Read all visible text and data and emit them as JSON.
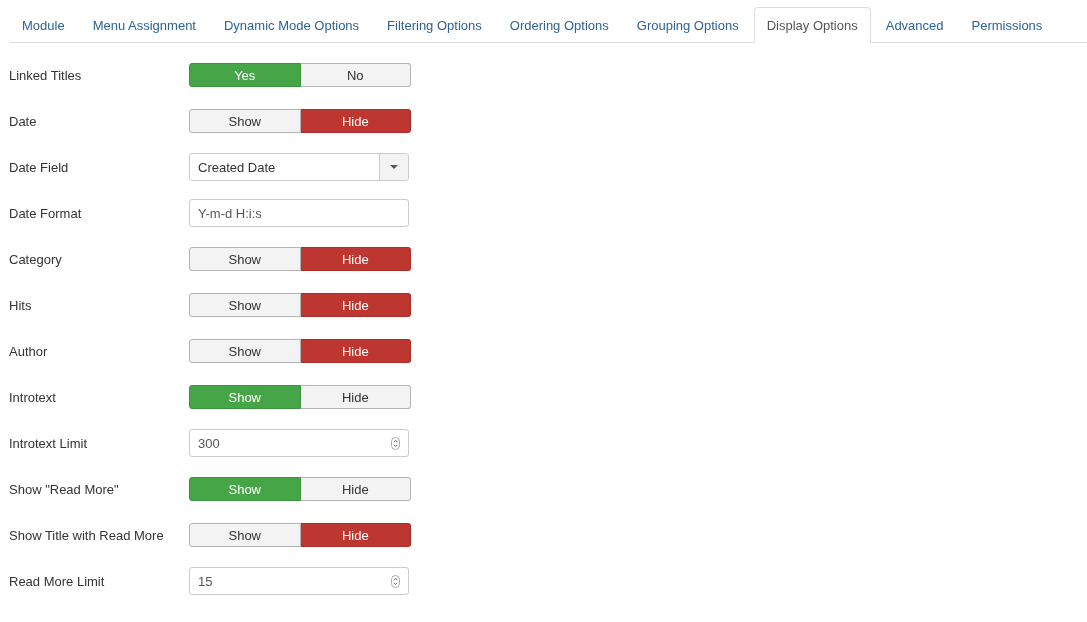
{
  "tabs": [
    {
      "label": "Module",
      "selected": false
    },
    {
      "label": "Menu Assignment",
      "selected": false
    },
    {
      "label": "Dynamic Mode Options",
      "selected": false
    },
    {
      "label": "Filtering Options",
      "selected": false
    },
    {
      "label": "Ordering Options",
      "selected": false
    },
    {
      "label": "Grouping Options",
      "selected": false
    },
    {
      "label": "Display Options",
      "selected": true
    },
    {
      "label": "Advanced",
      "selected": false
    },
    {
      "label": "Permissions",
      "selected": false
    }
  ],
  "fields": [
    {
      "label": "Linked Titles",
      "kind": "toggle",
      "options": [
        {
          "label": "Yes",
          "selected": true
        },
        {
          "label": "No",
          "selected": false
        }
      ]
    },
    {
      "label": "Date",
      "kind": "toggle",
      "options": [
        {
          "label": "Show",
          "selected": false
        },
        {
          "label": "Hide",
          "selected": true
        }
      ]
    },
    {
      "label": "Date Field",
      "kind": "select",
      "value": "Created Date"
    },
    {
      "label": "Date Format",
      "kind": "text",
      "value": "Y-m-d H:i:s"
    },
    {
      "label": "Category",
      "kind": "toggle",
      "options": [
        {
          "label": "Show",
          "selected": false
        },
        {
          "label": "Hide",
          "selected": true
        }
      ]
    },
    {
      "label": "Hits",
      "kind": "toggle",
      "options": [
        {
          "label": "Show",
          "selected": false
        },
        {
          "label": "Hide",
          "selected": true
        }
      ]
    },
    {
      "label": "Author",
      "kind": "toggle",
      "options": [
        {
          "label": "Show",
          "selected": false
        },
        {
          "label": "Hide",
          "selected": true
        }
      ]
    },
    {
      "label": "Introtext",
      "kind": "toggle",
      "options": [
        {
          "label": "Show",
          "selected": true
        },
        {
          "label": "Hide",
          "selected": false
        }
      ]
    },
    {
      "label": "Introtext Limit",
      "kind": "number",
      "value": "300"
    },
    {
      "label": "Show \"Read More\"",
      "kind": "toggle",
      "options": [
        {
          "label": "Show",
          "selected": true
        },
        {
          "label": "Hide",
          "selected": false
        }
      ]
    },
    {
      "label": "Show Title with Read More",
      "kind": "toggle",
      "options": [
        {
          "label": "Show",
          "selected": false
        },
        {
          "label": "Hide",
          "selected": true
        }
      ]
    },
    {
      "label": "Read More Limit",
      "kind": "number",
      "value": "15"
    }
  ]
}
